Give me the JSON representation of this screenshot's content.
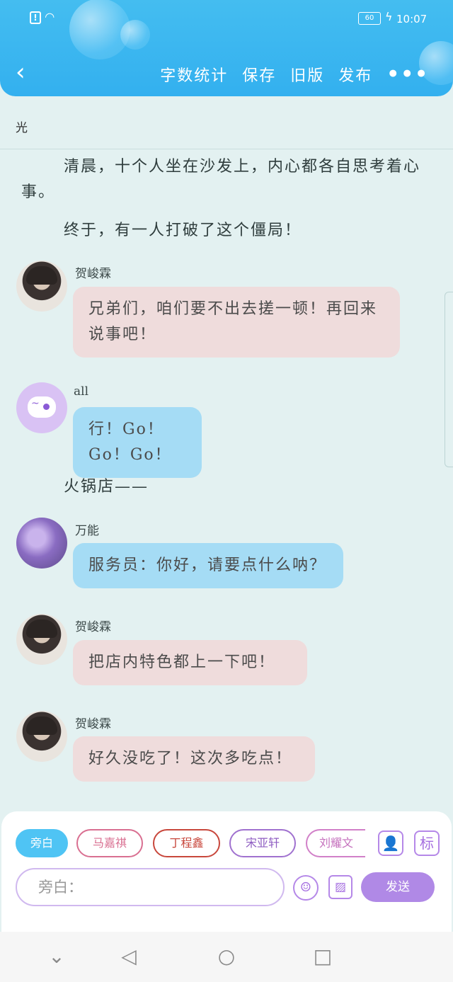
{
  "status_bar": {
    "battery": "60",
    "time": "10:07"
  },
  "toolbar": {
    "word_count": "字数统计",
    "save": "保存",
    "old_version": "旧版",
    "publish": "发布",
    "more": "•••"
  },
  "doc": {
    "title": "光"
  },
  "story": {
    "narr1": "清晨，十个人坐在沙发上，内心都各自思考着心事。",
    "narr2": "终于，有一人打破了这个僵局！",
    "narr3": "火锅店——",
    "messages": [
      {
        "name": "贺峻霖",
        "text": "兄弟们，咱们要不出去搓一顿！再回来说事吧！"
      },
      {
        "name": "all",
        "text": "行！Go！Go！Go！"
      },
      {
        "name": "万能",
        "text": "服务员：你好，请要点什么呐？"
      },
      {
        "name": "贺峻霖",
        "text": "把店内特色都上一下吧！"
      },
      {
        "name": "贺峻霖",
        "text": "好久没吃了！这次多吃点！"
      }
    ]
  },
  "input_panel": {
    "characters": [
      "旁白",
      "马嘉祺",
      "丁程鑫",
      "宋亚轩",
      "刘耀文"
    ],
    "person_btn": "👤",
    "mark_btn": "标",
    "placeholder": "旁白：",
    "emoji": "☺",
    "image": "▨",
    "send": "发送"
  },
  "nav": {
    "down": "⌄",
    "back": "◁",
    "home": "○",
    "recent": "□"
  }
}
